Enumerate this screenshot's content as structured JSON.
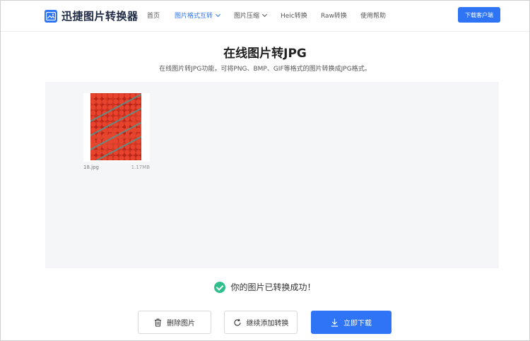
{
  "header": {
    "logo_text": "迅捷图片转换器",
    "nav": [
      {
        "label": "首页",
        "active": false,
        "dropdown": false
      },
      {
        "label": "图片格式互转",
        "active": true,
        "dropdown": true
      },
      {
        "label": "图片压缩",
        "active": false,
        "dropdown": true
      },
      {
        "label": "Heic转换",
        "active": false,
        "dropdown": false
      },
      {
        "label": "Raw转换",
        "active": false,
        "dropdown": false
      },
      {
        "label": "使用帮助",
        "active": false,
        "dropdown": false
      }
    ],
    "download_client_label": "下载客户端"
  },
  "main": {
    "title": "在线图片转JPG",
    "subtitle": "在线图片转JPG功能，可将PNG、BMP、GIF等格式的图片转换成JPG格式。"
  },
  "files": [
    {
      "name": "18.jpg",
      "size": "1.17MB"
    }
  ],
  "status": {
    "success_text": "你的图片已转换成功！"
  },
  "actions": {
    "delete_label": "删除图片",
    "continue_label": "继续添加转换",
    "download_label": "立即下载"
  },
  "colors": {
    "accent": "#2f74f5",
    "success": "#2fbf8c",
    "area_bg": "#f5f6f8"
  }
}
